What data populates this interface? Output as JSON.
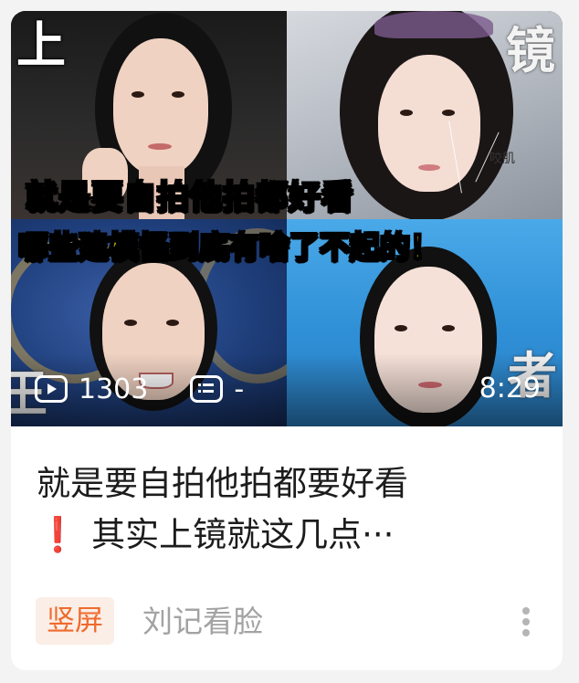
{
  "thumbnail": {
    "corner_chars": [
      "上",
      "镜",
      "王",
      "者"
    ],
    "banner_line1": "就是要自拍他拍都好看",
    "banner_line2": "哪些建模怪到底有啥了不起的！",
    "jaw_label": "咬肌",
    "views": "1303",
    "danmu": "-",
    "duration": "8:29"
  },
  "post": {
    "title_line1": "就是要自拍他拍都要好看",
    "title_emoji": "❗",
    "title_line2": "其实上镜就这几点···",
    "tag": "竖屏",
    "author": "刘记看脸"
  },
  "icons": {
    "views": "play-icon",
    "danmu": "danmu-icon",
    "more": "more-vertical-icon"
  },
  "colors": {
    "banner_text": "#ffe21a",
    "tag_text": "#ef6b2d",
    "tag_bg": "#fbeee6",
    "title_text": "#1c1c1c",
    "author_text": "#a3a3a3"
  }
}
